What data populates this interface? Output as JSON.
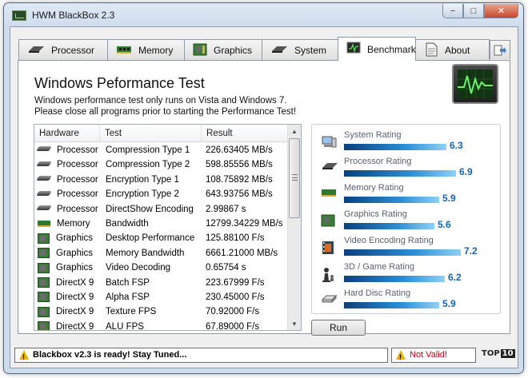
{
  "window": {
    "title": "HWM BlackBox 2.3",
    "min": "−",
    "max": "□",
    "close": "✕"
  },
  "tabs": [
    {
      "label": "Processor",
      "icon": "cpu-icon"
    },
    {
      "label": "Memory",
      "icon": "memory-icon"
    },
    {
      "label": "Graphics",
      "icon": "graphics-card-icon"
    },
    {
      "label": "System",
      "icon": "cpu-icon"
    },
    {
      "label": "Benchmark",
      "icon": "monitor-icon",
      "active": true
    },
    {
      "label": "About",
      "icon": "document-icon"
    }
  ],
  "benchmark": {
    "title": "Windows Peformance Test",
    "line1": "Windows performance test only runs on Vista and Windows 7.",
    "line2": "Please close all programs prior to starting the Performance Test!"
  },
  "table": {
    "headers": {
      "hardware": "Hardware",
      "test": "Test",
      "result": "Result"
    },
    "rows": [
      {
        "hw": "Processor",
        "icon": "cpu",
        "test": "Compression Type 1",
        "result": "226.63405 MB/s"
      },
      {
        "hw": "Processor",
        "icon": "cpu",
        "test": "Compression Type 2",
        "result": "598.85556 MB/s"
      },
      {
        "hw": "Processor",
        "icon": "cpu",
        "test": "Encryption Type 1",
        "result": "108.75892 MB/s"
      },
      {
        "hw": "Processor",
        "icon": "cpu",
        "test": "Encryption Type 2",
        "result": "643.93756 MB/s"
      },
      {
        "hw": "Processor",
        "icon": "cpu",
        "test": "DirectShow Encoding",
        "result": "2.99867 s"
      },
      {
        "hw": "Memory",
        "icon": "mem",
        "test": "Bandwidth",
        "result": "12799.34229 MB/s"
      },
      {
        "hw": "Graphics",
        "icon": "gpu",
        "test": "Desktop Performance",
        "result": "125.88100 F/s"
      },
      {
        "hw": "Graphics",
        "icon": "gpu",
        "test": "Memory Bandwidth",
        "result": "6661.21000 MB/s"
      },
      {
        "hw": "Graphics",
        "icon": "gpu",
        "test": "Video Decoding",
        "result": "0.65754 s"
      },
      {
        "hw": "DirectX 9",
        "icon": "gpu",
        "test": "Batch FSP",
        "result": "223.67999 F/s"
      },
      {
        "hw": "DirectX 9",
        "icon": "gpu",
        "test": "Alpha FSP",
        "result": "230.45000 F/s"
      },
      {
        "hw": "DirectX 9",
        "icon": "gpu",
        "test": "Texture FPS",
        "result": "70.92000 F/s"
      },
      {
        "hw": "DirectX 9",
        "icon": "gpu",
        "test": "ALU FPS",
        "result": "67.89000 F/s"
      }
    ]
  },
  "ratings": [
    {
      "label": "System Rating",
      "value": "6.3",
      "score": 6.3,
      "icon": "computer-icon"
    },
    {
      "label": "Processor Rating",
      "value": "6.9",
      "score": 6.9,
      "icon": "cpu-icon"
    },
    {
      "label": "Memory Rating",
      "value": "5.9",
      "score": 5.9,
      "icon": "memory-icon"
    },
    {
      "label": "Graphics Rating",
      "value": "5.6",
      "score": 5.6,
      "icon": "graphics-card-icon"
    },
    {
      "label": "Video Encoding Rating",
      "value": "7.2",
      "score": 7.2,
      "icon": "film-icon"
    },
    {
      "label": "3D / Game Rating",
      "value": "6.2",
      "score": 6.2,
      "icon": "chess-piece-icon"
    },
    {
      "label": "Hard Disc Rating",
      "value": "5.9",
      "score": 5.9,
      "icon": "hard-disk-icon"
    }
  ],
  "run_button": "Run",
  "status": {
    "message": "Blackbox v2.3 is ready! Stay Tuned...",
    "validity": "Not Valid!",
    "logo_text": "TOP",
    "logo_num": "10"
  },
  "colors": {
    "rating_value": "#1565a8",
    "invalid": "#c3001b",
    "bar_dark": "#0b3f7e",
    "bar_light": "#8fd0f5"
  }
}
